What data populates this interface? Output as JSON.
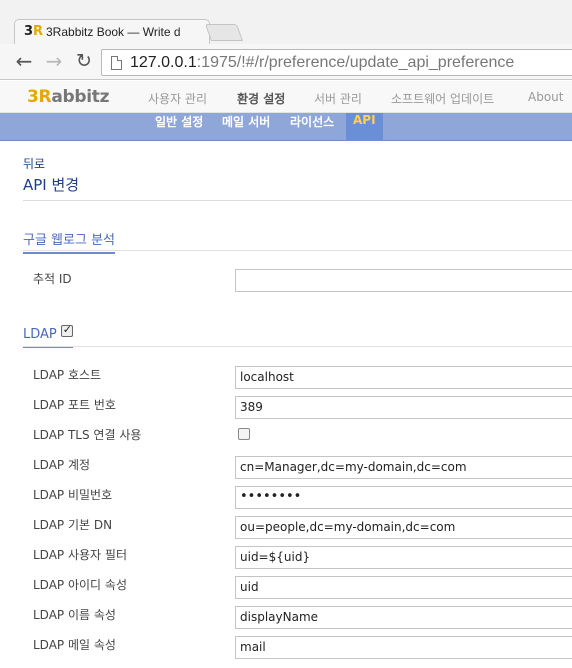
{
  "browser": {
    "tab_logo_prefix": "3",
    "tab_logo_suffix": "R",
    "tab_title": "3Rabbitz Book — Write d",
    "url_host": "127.0.0.1",
    "url_rest": ":1975/!#/r/preference/update_api_preference"
  },
  "app": {
    "brand_prefix": "3R",
    "brand_suffix": "abbitz",
    "menu": [
      {
        "label": "사용자 관리"
      },
      {
        "label": "환경 설정"
      },
      {
        "label": "서버 관리"
      },
      {
        "label": "소프트웨어 업데이트"
      },
      {
        "label": "About"
      }
    ],
    "submenu": [
      {
        "label": "일반 설정"
      },
      {
        "label": "메일 서버"
      },
      {
        "label": "라이선스"
      },
      {
        "label": "API"
      }
    ]
  },
  "page": {
    "back_label": "뒤로",
    "title": "API 변경"
  },
  "google": {
    "heading": "구글 웹로그 분석",
    "tracking_label": "추적 ID",
    "tracking_value": ""
  },
  "ldap": {
    "heading": "LDAP",
    "enabled": true,
    "fields": [
      {
        "label": "LDAP 호스트",
        "value": "localhost"
      },
      {
        "label": "LDAP 포트 번호",
        "value": "389"
      },
      {
        "label": "LDAP TLS 연결 사용",
        "value": ""
      },
      {
        "label": "LDAP 계정",
        "value": "cn=Manager,dc=my-domain,dc=com"
      },
      {
        "label": "LDAP 비밀번호",
        "value": "••••••••"
      },
      {
        "label": "LDAP 기본 DN",
        "value": "ou=people,dc=my-domain,dc=com"
      },
      {
        "label": "LDAP 사용자 필터",
        "value": "uid=${uid}"
      },
      {
        "label": "LDAP 아이디 속성",
        "value": "uid"
      },
      {
        "label": "LDAP 이름 속성",
        "value": "displayName"
      },
      {
        "label": "LDAP 메일 속성",
        "value": "mail"
      }
    ]
  },
  "colors": {
    "subnav": "#8ea6d8",
    "subnav_active": "#6b8fd6",
    "accent_text": "#1f3f88",
    "brand_r": "#e8a600"
  }
}
